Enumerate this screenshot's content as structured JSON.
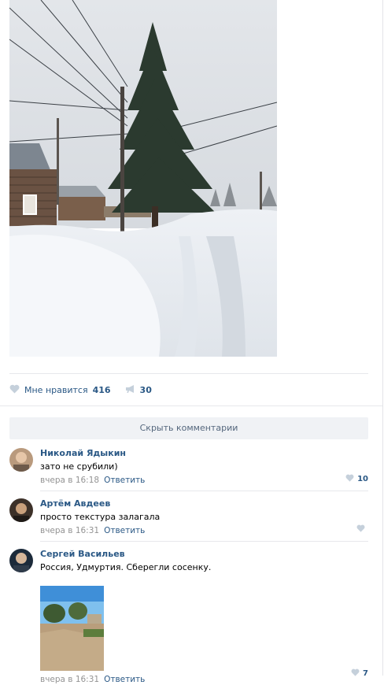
{
  "post": {
    "like_label": "Мне нравится",
    "like_count": "416",
    "share_count": "30"
  },
  "comments_toggle": "Скрыть комментарии",
  "comments": [
    {
      "author": "Николай Ядыкин",
      "text": "зато не срубили)",
      "time": "вчера в 16:18",
      "reply": "Ответить",
      "likes": "10"
    },
    {
      "author": "Артём Авдеев",
      "text": "просто текстура залагала",
      "time": "вчера в 16:31",
      "reply": "Ответить",
      "likes": ""
    },
    {
      "author": "Сергей Васильев",
      "text": "Россия, Удмуртия. Сберегли сосенку.",
      "time": "вчера в 16:31",
      "reply": "Ответить",
      "likes": "7"
    }
  ],
  "colors": {
    "link": "#2a5885",
    "meta": "#939393",
    "bar": "#f0f2f5",
    "heart": "#c5d0db"
  },
  "icons": {
    "like": "heart-icon",
    "share": "megaphone-icon"
  }
}
